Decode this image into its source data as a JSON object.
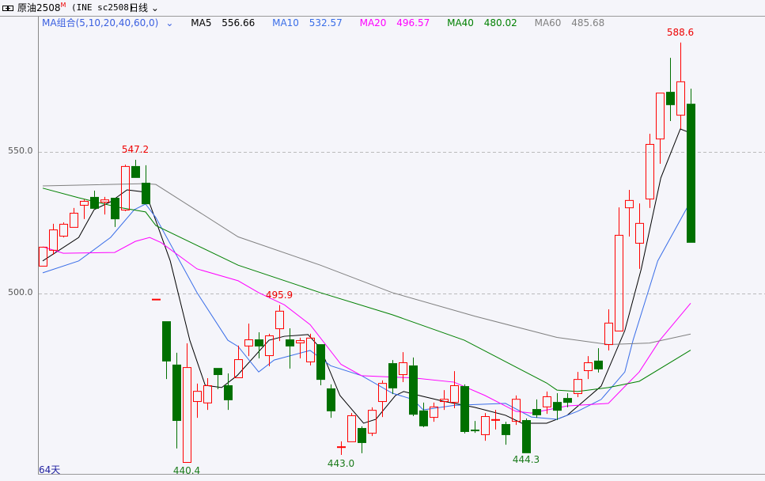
{
  "title": {
    "name": "原油2508",
    "marker": "M",
    "code": "(INE sc2508)",
    "period": "日线"
  },
  "legend": {
    "combo": "MA组合(5,10,20,40,60,0)",
    "items": [
      {
        "label": "MA5",
        "value": "556.66",
        "color": "#000000"
      },
      {
        "label": "MA10",
        "value": "532.57",
        "color": "#3a6ee8"
      },
      {
        "label": "MA20",
        "value": "496.57",
        "color": "#ff00ff"
      },
      {
        "label": "MA40",
        "value": "480.02",
        "color": "#008000"
      },
      {
        "label": "MA60",
        "value": "485.68",
        "color": "#808080"
      }
    ]
  },
  "colors": {
    "up": "#ff0000",
    "down": "#007000"
  },
  "axis": {
    "labels": [
      "550.0",
      "500.0"
    ],
    "ticks": [
      550,
      500
    ]
  },
  "days_label": "64天",
  "price_labels": [
    {
      "text": "547.2",
      "index": 9,
      "price": 547.2,
      "kind": "high"
    },
    {
      "text": "495.9",
      "index": 23,
      "price": 495.9,
      "kind": "high"
    },
    {
      "text": "440.4",
      "index": 14,
      "price": 440.4,
      "kind": "low"
    },
    {
      "text": "443.0",
      "index": 29,
      "price": 443.0,
      "kind": "low"
    },
    {
      "text": "444.3",
      "index": 47,
      "price": 444.3,
      "kind": "low"
    },
    {
      "text": "588.6",
      "index": 62,
      "price": 588.6,
      "kind": "high"
    }
  ],
  "chart_data": {
    "type": "candlestick",
    "ohlc": [
      [
        509.8,
        516.5,
        509.8,
        516.5
      ],
      [
        515.4,
        524.6,
        513.7,
        522.6
      ],
      [
        520.4,
        525.1,
        519.8,
        524.6
      ],
      [
        523.5,
        530.2,
        523.5,
        528.5
      ],
      [
        531.3,
        533.2,
        526.3,
        532.7
      ],
      [
        534.1,
        536.3,
        530.2,
        530.2
      ],
      [
        532.4,
        534.1,
        527.9,
        533.2
      ],
      [
        533.8,
        533.8,
        523.5,
        526.5
      ],
      [
        529.6,
        545.5,
        529.1,
        545.0
      ],
      [
        545.0,
        547.2,
        541.1,
        541.1
      ],
      [
        539.1,
        545.3,
        531.8,
        531.8
      ],
      [
        498.0,
        498.0,
        498.0,
        498.0
      ],
      [
        490.2,
        490.2,
        469.8,
        476.3
      ],
      [
        474.9,
        479.1,
        445.3,
        455.3
      ],
      [
        440.5,
        482.4,
        440.4,
        474.0
      ],
      [
        462.0,
        468.2,
        456.1,
        465.6
      ],
      [
        461.5,
        470.1,
        458.9,
        467.6
      ],
      [
        473.7,
        473.7,
        466.2,
        471.5
      ],
      [
        467.6,
        471.8,
        458.9,
        462.6
      ],
      [
        470.4,
        481.6,
        470.4,
        476.8
      ],
      [
        481.6,
        489.4,
        477.9,
        483.8
      ],
      [
        483.8,
        486.3,
        477.1,
        481.6
      ],
      [
        478.2,
        485.8,
        474.3,
        485.2
      ],
      [
        487.7,
        495.9,
        483.2,
        493.9
      ],
      [
        483.8,
        487.7,
        473.5,
        481.6
      ],
      [
        482.7,
        484.4,
        477.1,
        483.5
      ],
      [
        476.0,
        485.8,
        474.6,
        484.4
      ],
      [
        482.1,
        482.1,
        467.6,
        469.8
      ],
      [
        466.5,
        467.9,
        456.1,
        458.7
      ],
      [
        445.6,
        447.8,
        443.0,
        445.9
      ],
      [
        447.8,
        457.8,
        447.8,
        457.0
      ],
      [
        452.5,
        453.1,
        443.6,
        447.5
      ],
      [
        450.8,
        459.8,
        449.7,
        458.9
      ],
      [
        462.0,
        469.3,
        456.4,
        468.4
      ],
      [
        475.4,
        476.5,
        464.5,
        466.8
      ],
      [
        471.5,
        479.3,
        468.7,
        475.7
      ],
      [
        474.6,
        477.4,
        456.7,
        457.5
      ],
      [
        458.7,
        461.5,
        452.8,
        453.4
      ],
      [
        456.4,
        461.5,
        454.7,
        460.1
      ],
      [
        462.0,
        465.9,
        458.9,
        462.8
      ],
      [
        461.7,
        472.6,
        459.5,
        467.6
      ],
      [
        467.3,
        467.9,
        450.6,
        451.4
      ],
      [
        451.8,
        455.0,
        450.8,
        451.4
      ],
      [
        450.3,
        457.8,
        448.0,
        456.7
      ],
      [
        455.2,
        458.9,
        452.0,
        455.5
      ],
      [
        453.9,
        454.7,
        446.6,
        450.3
      ],
      [
        455.0,
        464.0,
        453.6,
        462.8
      ],
      [
        455.3,
        455.9,
        444.3,
        443.9
      ],
      [
        459.2,
        462.6,
        456.1,
        457.3
      ],
      [
        460.1,
        465.4,
        457.5,
        463.7
      ],
      [
        461.7,
        464.8,
        455.3,
        458.9
      ],
      [
        463.1,
        464.8,
        459.8,
        461.7
      ],
      [
        464.8,
        472.3,
        463.4,
        469.8
      ],
      [
        472.9,
        477.9,
        469.8,
        475.7
      ],
      [
        476.3,
        480.7,
        472.1,
        473.5
      ],
      [
        482.1,
        494.4,
        479.9,
        489.7
      ],
      [
        486.9,
        530.4,
        486.9,
        520.7
      ],
      [
        530.4,
        536.6,
        520.1,
        533.0
      ],
      [
        517.9,
        531.8,
        508.7,
        524.9
      ],
      [
        533.5,
        556.4,
        530.2,
        552.8
      ],
      [
        554.7,
        570.9,
        545.8,
        570.9
      ],
      [
        571.2,
        583.2,
        560.9,
        566.8
      ],
      [
        563.1,
        588.6,
        558.1,
        574.9
      ],
      [
        567.0,
        572.3,
        518.2,
        518.2
      ]
    ],
    "ohlc_order": [
      "open",
      "high",
      "low",
      "close"
    ],
    "ma": {
      "MA5": [
        [
          0,
          511.5
        ],
        [
          3.5,
          519.8
        ],
        [
          5,
          529.6
        ],
        [
          6.6,
          532.4
        ],
        [
          8.2,
          536.6
        ],
        [
          10,
          535.8
        ],
        [
          12.4,
          511.5
        ],
        [
          14.3,
          483.5
        ],
        [
          15.8,
          467.6
        ],
        [
          17.4,
          466.8
        ],
        [
          18.9,
          471
        ],
        [
          22,
          483.5
        ],
        [
          23.5,
          484.9
        ],
        [
          25.8,
          485.5
        ],
        [
          27,
          480.7
        ],
        [
          28.9,
          464
        ],
        [
          31.2,
          454.2
        ],
        [
          32.4,
          455.6
        ],
        [
          34.3,
          464
        ],
        [
          35.1,
          465.4
        ],
        [
          36.6,
          464
        ],
        [
          38.9,
          462
        ],
        [
          42,
          459.8
        ],
        [
          45,
          457
        ],
        [
          46.6,
          454.2
        ],
        [
          49,
          454.2
        ],
        [
          51,
          457
        ],
        [
          54.3,
          467.3
        ],
        [
          56.6,
          486.9
        ],
        [
          58.2,
          508.7
        ],
        [
          60.1,
          540.8
        ],
        [
          62,
          558.1
        ],
        [
          63,
          556.66
        ]
      ],
      "MA10": [
        [
          0,
          507.3
        ],
        [
          3.5,
          511.5
        ],
        [
          6.6,
          519.8
        ],
        [
          8.9,
          529.6
        ],
        [
          10,
          531.6
        ],
        [
          11,
          526.8
        ],
        [
          15,
          500.3
        ],
        [
          18,
          483.5
        ],
        [
          19,
          481.3
        ],
        [
          21,
          472.3
        ],
        [
          22.5,
          476.5
        ],
        [
          26,
          479.9
        ],
        [
          28,
          474.5
        ],
        [
          31,
          471
        ],
        [
          34,
          464.8
        ],
        [
          36,
          462.6
        ],
        [
          37,
          458.9
        ],
        [
          40,
          460.5
        ],
        [
          45,
          461.2
        ],
        [
          47.5,
          456.4
        ],
        [
          50,
          455.6
        ],
        [
          52,
          458.4
        ],
        [
          54.3,
          462.6
        ],
        [
          56.6,
          472.3
        ],
        [
          57.4,
          483.5
        ],
        [
          59.8,
          511.5
        ],
        [
          63,
          532.57
        ]
      ],
      "MA20": [
        [
          0,
          516.5
        ],
        [
          2,
          514.2
        ],
        [
          7,
          514.5
        ],
        [
          9,
          518.4
        ],
        [
          10.4,
          519.8
        ],
        [
          11.5,
          518
        ],
        [
          15,
          508.7
        ],
        [
          19,
          504.5
        ],
        [
          21,
          500.3
        ],
        [
          23.5,
          496
        ],
        [
          26,
          489
        ],
        [
          29,
          475
        ],
        [
          31,
          471
        ],
        [
          34,
          470.5
        ],
        [
          36,
          470.2
        ],
        [
          40,
          468.7
        ],
        [
          43,
          464
        ],
        [
          46,
          458.4
        ],
        [
          47.5,
          457.8
        ],
        [
          51,
          460.3
        ],
        [
          55,
          461.2
        ],
        [
          56.5,
          466.8
        ],
        [
          58,
          472.3
        ],
        [
          60,
          483.5
        ],
        [
          63,
          496.57
        ]
      ],
      "MA40": [
        [
          0,
          537.2
        ],
        [
          3.5,
          533.8
        ],
        [
          7.4,
          530.4
        ],
        [
          10,
          528.8
        ],
        [
          11,
          524
        ],
        [
          15,
          517
        ],
        [
          19,
          510
        ],
        [
          27,
          500.3
        ],
        [
          34,
          492.5
        ],
        [
          41,
          483.5
        ],
        [
          49,
          468.4
        ],
        [
          50,
          465.9
        ],
        [
          52,
          465.4
        ],
        [
          55,
          466.8
        ],
        [
          58,
          469
        ],
        [
          63,
          480.02
        ]
      ],
      "MA60": [
        [
          0,
          538.0
        ],
        [
          10,
          538.8
        ],
        [
          11,
          538.5
        ],
        [
          19,
          520
        ],
        [
          27,
          510
        ],
        [
          34,
          500.3
        ],
        [
          42,
          492
        ],
        [
          50,
          484.5
        ],
        [
          55,
          482
        ],
        [
          59,
          482.5
        ],
        [
          63,
          485.68
        ]
      ]
    },
    "ylim": [
      438,
      592
    ]
  }
}
